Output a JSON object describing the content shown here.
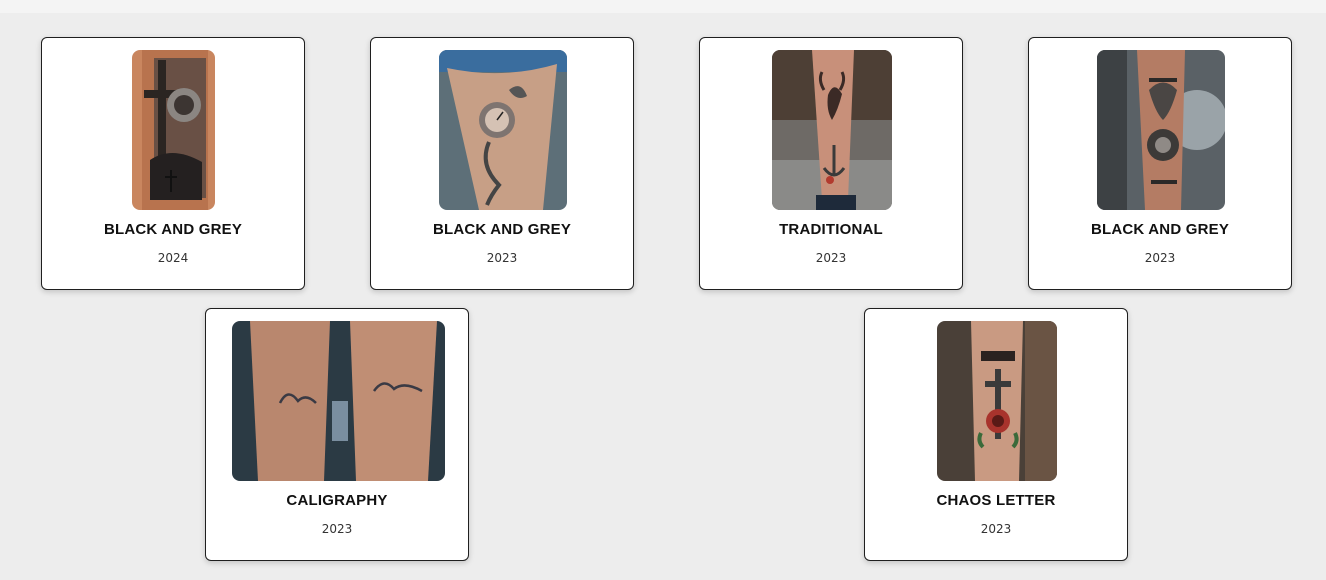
{
  "gallery": {
    "cards": [
      {
        "title": "BLACK AND GREY",
        "year": "2024",
        "image": "lion-cross-forearm-tattoo-photo"
      },
      {
        "title": "BLACK AND GREY",
        "year": "2023",
        "image": "pocket-watch-thigh-tattoo-photo"
      },
      {
        "title": "TRADITIONAL",
        "year": "2023",
        "image": "scorpion-anchor-calf-tattoo-photo"
      },
      {
        "title": "BLACK AND GREY",
        "year": "2023",
        "image": "wolf-compass-forearm-tattoo-photo"
      },
      {
        "title": "CALIGRAPHY",
        "year": "2023",
        "image": "names-forearms-tattoo-photo"
      },
      {
        "title": "CHAOS LETTER",
        "year": "2023",
        "image": "chaos-dagger-rose-tattoo-photo"
      }
    ]
  },
  "colors": {
    "page_background": "#ededed",
    "card_background": "#ffffff",
    "card_border": "#1f1f1f",
    "title_text": "#111111"
  }
}
